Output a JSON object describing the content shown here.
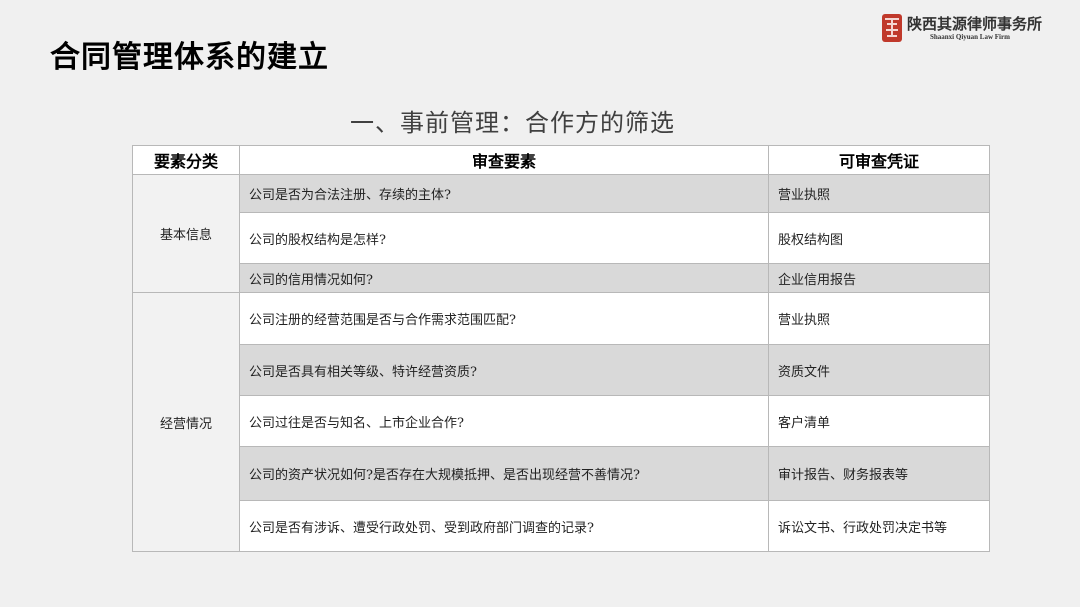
{
  "slide": {
    "title": "合同管理体系的建立",
    "subtitle": "一、事前管理：合作方的筛选"
  },
  "logo": {
    "name_cn": "陕西其源律师事务所",
    "name_en": "Shaanxi Qiyuan Law Firm",
    "seal_color": "#c0392b"
  },
  "table": {
    "headers": [
      "要素分类",
      "审查要素",
      "可审查凭证"
    ],
    "groups": [
      {
        "category": "基本信息",
        "rows": [
          {
            "item": "公司是否为合法注册、存续的主体?",
            "proof": "营业执照"
          },
          {
            "item": "公司的股权结构是怎样?",
            "proof": "股权结构图"
          },
          {
            "item": "公司的信用情况如何?",
            "proof": "企业信用报告"
          }
        ]
      },
      {
        "category": "经营情况",
        "rows": [
          {
            "item": "公司注册的经营范围是否与合作需求范围匹配?",
            "proof": "营业执照"
          },
          {
            "item": "公司是否具有相关等级、特许经营资质?",
            "proof": "资质文件"
          },
          {
            "item": "公司过往是否与知名、上市企业合作?",
            "proof": "客户清单"
          },
          {
            "item": "公司的资产状况如何?是否存在大规模抵押、是否出现经营不善情况?",
            "proof": "审计报告、财务报表等"
          },
          {
            "item": "公司是否有涉诉、遭受行政处罚、受到政府部门调查的记录?",
            "proof": "诉讼文书、行政处罚决定书等"
          }
        ]
      }
    ]
  }
}
